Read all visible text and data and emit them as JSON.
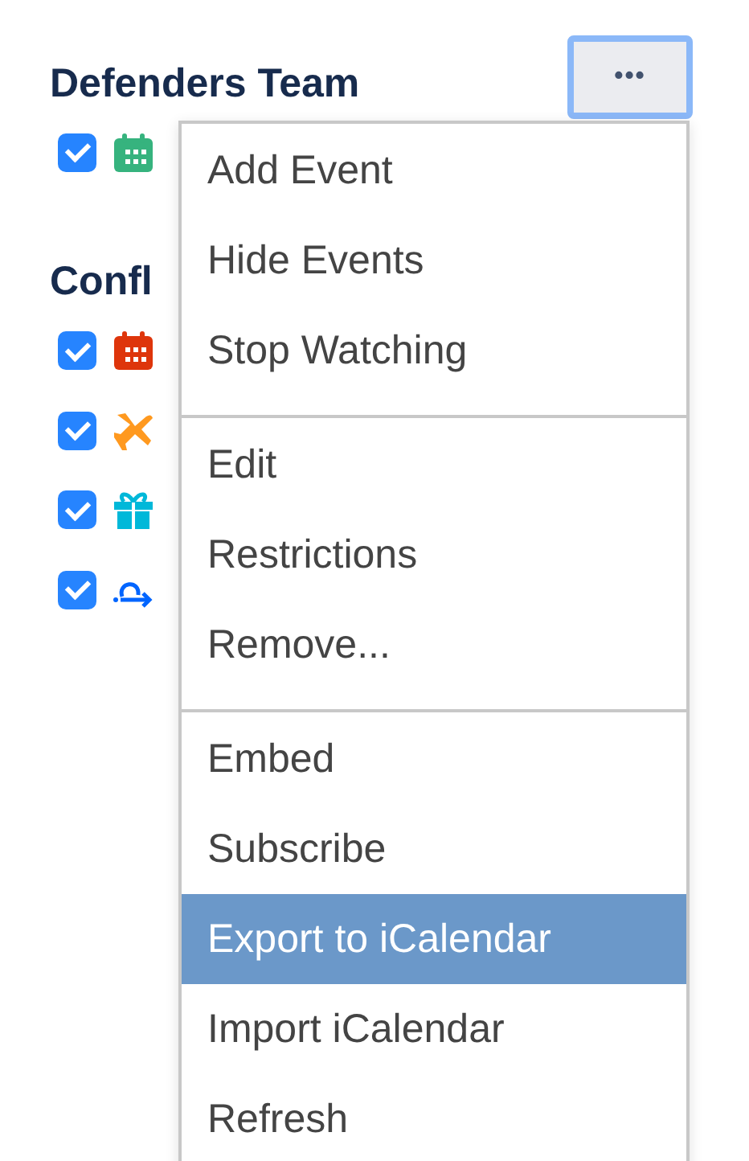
{
  "groups": [
    {
      "title": "Defenders Team",
      "calendars": [
        {
          "kind": "calendar",
          "color": "#36b37e",
          "checked": true
        }
      ]
    },
    {
      "title": "Confl",
      "calendars": [
        {
          "kind": "calendar",
          "color": "#de350b",
          "checked": true
        },
        {
          "kind": "plane",
          "color": "#ff991f",
          "checked": true
        },
        {
          "kind": "gift",
          "color": "#00b8d9",
          "checked": true
        },
        {
          "kind": "route",
          "color": "#0065ff",
          "checked": true
        }
      ]
    }
  ],
  "more_button": {
    "label": "•••",
    "focused": true
  },
  "menu": {
    "sections": [
      [
        {
          "label": "Add Event",
          "selected": false
        },
        {
          "label": "Hide Events",
          "selected": false
        },
        {
          "label": "Stop Watching",
          "selected": false
        }
      ],
      [
        {
          "label": "Edit",
          "selected": false
        },
        {
          "label": "Restrictions",
          "selected": false
        },
        {
          "label": "Remove...",
          "selected": false
        }
      ],
      [
        {
          "label": "Embed",
          "selected": false
        },
        {
          "label": "Subscribe",
          "selected": false
        },
        {
          "label": "Export to iCalendar",
          "selected": true
        },
        {
          "label": "Import iCalendar",
          "selected": false
        },
        {
          "label": "Refresh",
          "selected": false
        }
      ]
    ]
  }
}
